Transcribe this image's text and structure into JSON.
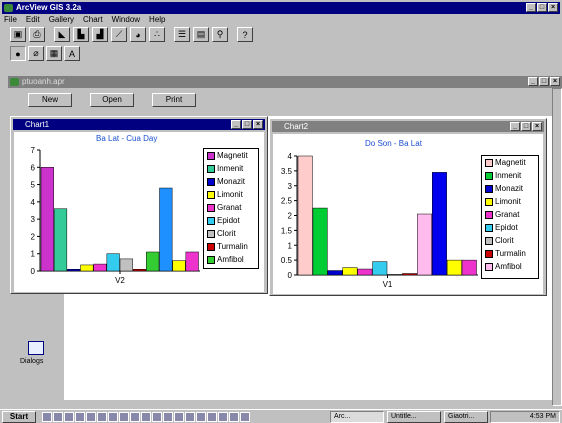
{
  "app": {
    "title": "ArcView GIS 3.2a",
    "menu": [
      "File",
      "Edit",
      "Gallery",
      "Chart",
      "Window",
      "Help"
    ]
  },
  "project_window": {
    "title": "ptuoanh.apr",
    "buttons": [
      "New",
      "Open",
      "Print"
    ],
    "dialogs_label": "Dialogs"
  },
  "chart_data": [
    {
      "type": "bar",
      "window_title": "Chart1",
      "title": "Ba Lat - Cua Day",
      "categories": [
        "V2"
      ],
      "ylim": [
        0,
        7
      ],
      "yticks": [
        0,
        1,
        2,
        3,
        4,
        5,
        6,
        7
      ],
      "series": [
        {
          "name": "Magnetit",
          "color": "#cc33cc",
          "values": [
            6.0
          ]
        },
        {
          "name": "Inmenit",
          "color": "#33cc99",
          "values": [
            3.6
          ]
        },
        {
          "name": "Monazit",
          "color": "#0000cc",
          "values": [
            0.1
          ]
        },
        {
          "name": "Limonit",
          "color": "#ffff00",
          "values": [
            0.35
          ]
        },
        {
          "name": "Granat",
          "color": "#ee33cc",
          "values": [
            0.4
          ]
        },
        {
          "name": "Epidot",
          "color": "#33ccee",
          "values": [
            1.0
          ]
        },
        {
          "name": "Clorit",
          "color": "#c0c0c0",
          "values": [
            0.7
          ]
        },
        {
          "name": "Turmalin",
          "color": "#cc0000",
          "values": [
            0.1
          ]
        },
        {
          "name": "Amfibol",
          "color": "#33cc33",
          "values": [
            1.1
          ]
        },
        {
          "name": "",
          "color": "#1e90ff",
          "values": [
            4.8
          ]
        },
        {
          "name": "",
          "color": "#ffff00",
          "values": [
            0.6
          ]
        },
        {
          "name": "",
          "color": "#ee33cc",
          "values": [
            1.1
          ]
        }
      ]
    },
    {
      "type": "bar",
      "window_title": "Chart2",
      "title": "Do Son - Ba Lat",
      "categories": [
        "V1"
      ],
      "ylim": [
        0,
        4
      ],
      "yticks": [
        0,
        0.5,
        1,
        1.5,
        2,
        2.5,
        3,
        3.5,
        4
      ],
      "series": [
        {
          "name": "Magnetit",
          "color": "#ffcccc",
          "values": [
            4.0
          ]
        },
        {
          "name": "Inmenit",
          "color": "#00cc33",
          "values": [
            2.25
          ]
        },
        {
          "name": "Monazit",
          "color": "#0000cc",
          "values": [
            0.15
          ]
        },
        {
          "name": "Limonit",
          "color": "#ffff00",
          "values": [
            0.25
          ]
        },
        {
          "name": "Granat",
          "color": "#ee33cc",
          "values": [
            0.2
          ]
        },
        {
          "name": "Epidot",
          "color": "#33ccee",
          "values": [
            0.45
          ]
        },
        {
          "name": "Clorit",
          "color": "#c0c0c0",
          "values": [
            0.02
          ]
        },
        {
          "name": "Turmalin",
          "color": "#cc0000",
          "values": [
            0.05
          ]
        },
        {
          "name": "Amfibol",
          "color": "#ffbbee",
          "values": [
            2.05
          ]
        },
        {
          "name": "",
          "color": "#0000ee",
          "values": [
            3.45
          ]
        },
        {
          "name": "",
          "color": "#ffff00",
          "values": [
            0.5
          ]
        },
        {
          "name": "",
          "color": "#ee33cc",
          "values": [
            0.5
          ]
        }
      ]
    }
  ],
  "taskbar": {
    "start": "Start",
    "tasks": [
      "Arc...",
      "Untitle...",
      "Giaotri..."
    ],
    "clock": "4:53 PM"
  },
  "colors": {
    "active_title": "#000080",
    "inactive_title": "#808080",
    "chart_title_text": "#1a4fd0"
  }
}
